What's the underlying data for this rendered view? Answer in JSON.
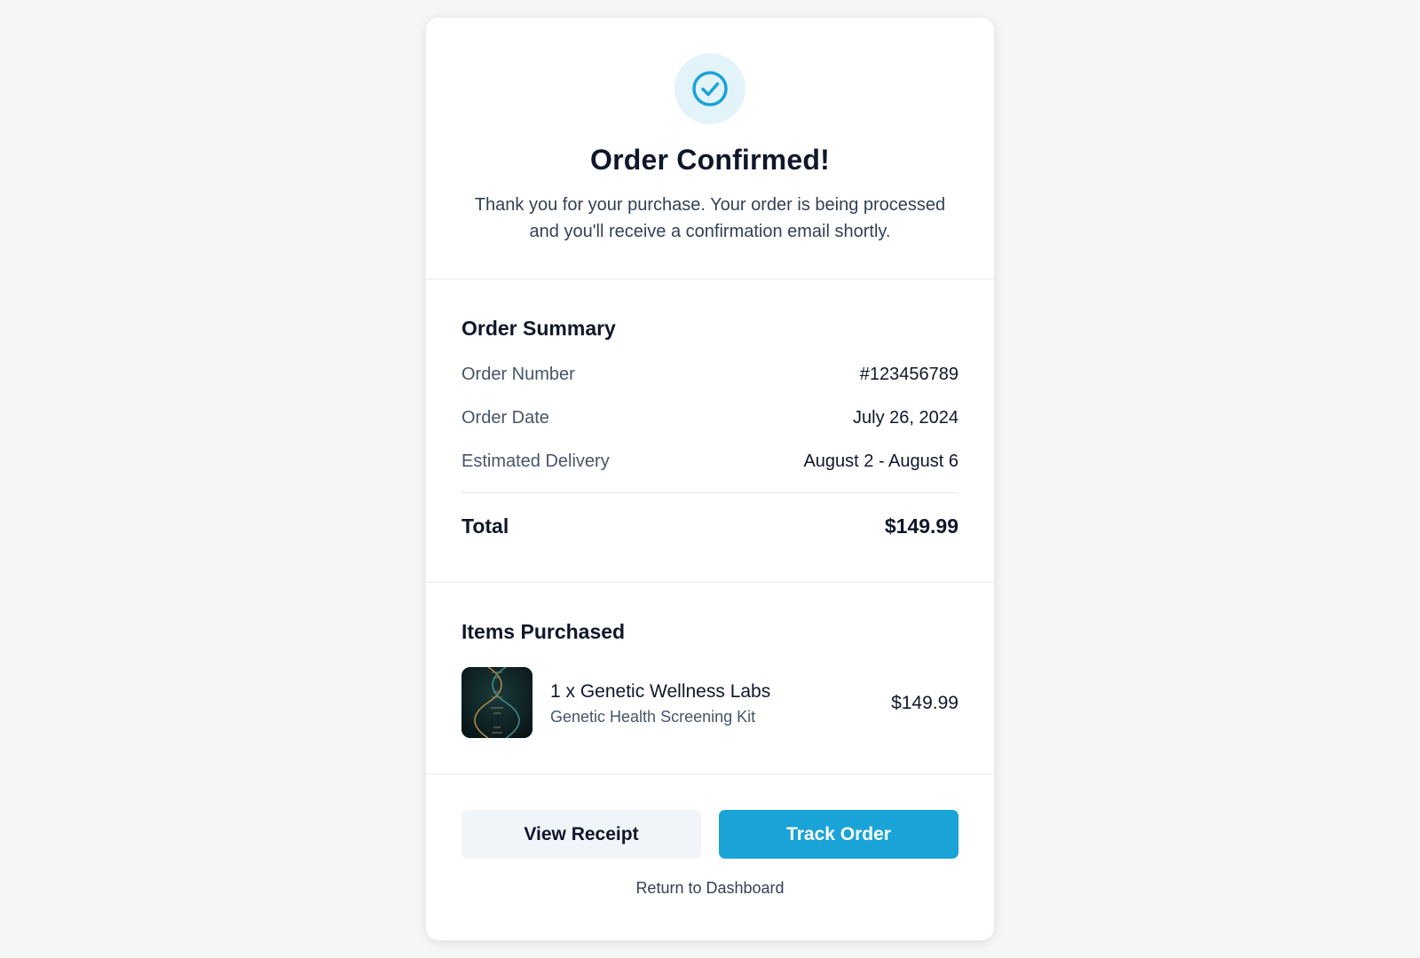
{
  "header": {
    "icon": "check-circle-icon",
    "title": "Order Confirmed!",
    "subtitle_line1": "Thank you for your purchase. Your order is being processed",
    "subtitle_line2": "and you'll receive a confirmation email shortly."
  },
  "summary": {
    "title": "Order Summary",
    "rows": [
      {
        "label": "Order Number",
        "value": "#123456789"
      },
      {
        "label": "Order Date",
        "value": "July 26, 2024"
      },
      {
        "label": "Estimated Delivery",
        "value": "August 2 - August 6"
      }
    ],
    "total_label": "Total",
    "total_value": "$149.99"
  },
  "items": {
    "title": "Items Purchased",
    "list": [
      {
        "image_icon": "dna-helix-image",
        "name": "1 x Genetic Wellness Labs",
        "description": "Genetic Health Screening Kit",
        "price": "$149.99"
      }
    ]
  },
  "actions": {
    "view_receipt": "View Receipt",
    "track_order": "Track Order",
    "return_link": "Return to Dashboard"
  },
  "colors": {
    "accent": "#1aa3d6",
    "accent_light": "#e3f3fa",
    "background": "#f5f7f6"
  }
}
